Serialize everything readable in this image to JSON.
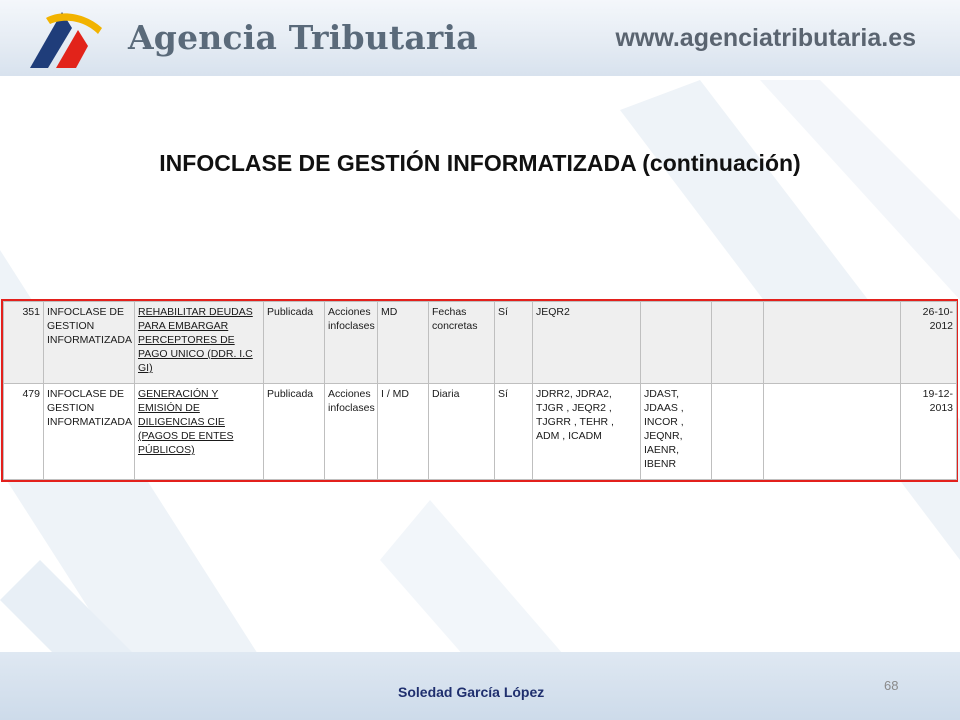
{
  "header": {
    "brand": "Agencia Tributaria",
    "site_url": "www.agenciatributaria.es",
    "logo_icon": "agencia-tributaria-logo"
  },
  "title": "INFOCLASE DE GESTIÓN INFORMATIZADA (continuación)",
  "table": {
    "rows": [
      {
        "num": "351",
        "tipo": "INFOCLASE DE GESTION INFORMATIZADA",
        "titulo": "REHABILITAR DEUDAS PARA EMBARGAR PERCEPTORES DE PAGO UNICO (DDR. I.C GI)",
        "estado": "Publicada",
        "accion": "Acciones infoclases",
        "codigo": "MD",
        "periodicidad": "Fechas concretas",
        "si": "Sí",
        "transacciones": "JEQR2",
        "otras": "",
        "extra1": "",
        "extra2": "",
        "fecha": "26-10-2012"
      },
      {
        "num": "479",
        "tipo": "INFOCLASE DE GESTION INFORMATIZADA",
        "titulo": "GENERACIÓN Y EMISIÓN DE DILIGENCIAS CIE (PAGOS DE ENTES PÚBLICOS)",
        "estado": "Publicada",
        "accion": "Acciones infoclases",
        "codigo": "I / MD",
        "periodicidad": "Diaria",
        "si": "Sí",
        "transacciones": "JDRR2, JDRA2, TJGR , JEQR2 , TJGRR , TEHR , ADM , ICADM",
        "otras": "JDAST, JDAAS , INCOR , JEQNR, IAENR, IBENR",
        "extra1": "",
        "extra2": "",
        "fecha": "19-12-2013"
      }
    ]
  },
  "footer": {
    "author": "Soledad García López",
    "page_number": "68"
  },
  "colors": {
    "highlight_border": "#e3201c",
    "author_text": "#1f2f6e"
  }
}
